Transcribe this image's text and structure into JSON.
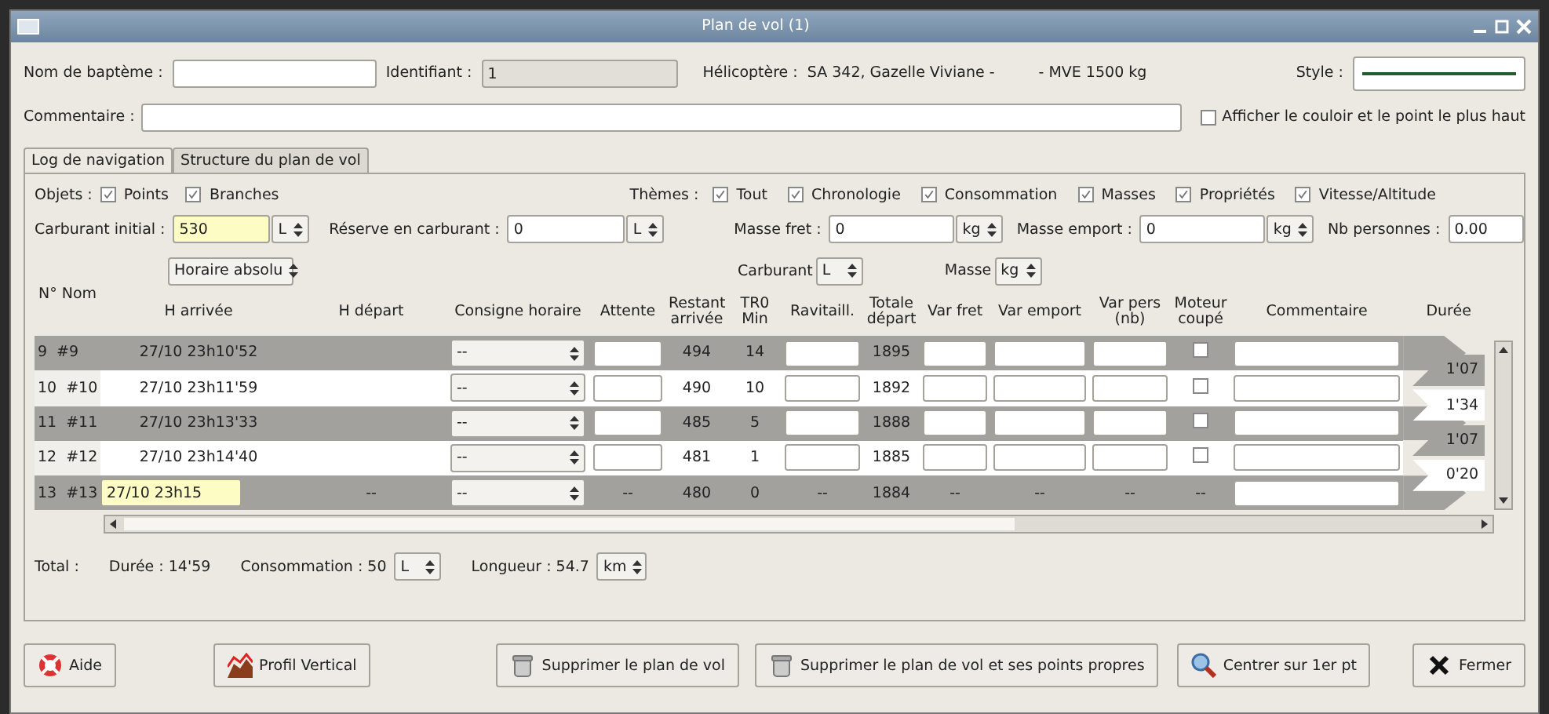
{
  "window": {
    "title": "Plan de vol (1)"
  },
  "header": {
    "name_label": "Nom de baptème :",
    "id_label": "Identifiant :",
    "id_value": "1",
    "helicopter_label": "Hélicoptère :",
    "helicopter": "SA 342, Gazelle Viviane -",
    "mve": "- MVE 1500 kg",
    "style_label": "Style :",
    "comment_label": "Commentaire :",
    "corridor": {
      "label": "Afficher le couloir et le point le plus haut",
      "checked": false
    }
  },
  "tabs": [
    {
      "label": "Log de navigation",
      "selected": true
    },
    {
      "label": "Structure du plan de vol",
      "selected": false
    }
  ],
  "filters": {
    "objects_label": "Objets :",
    "objects": [
      {
        "label": "Points",
        "checked": true
      },
      {
        "label": "Branches",
        "checked": true
      }
    ],
    "themes_label": "Thèmes :",
    "themes": [
      {
        "label": "Tout",
        "checked": true
      },
      {
        "label": "Chronologie",
        "checked": true
      },
      {
        "label": "Consommation",
        "checked": true
      },
      {
        "label": "Masses",
        "checked": true
      },
      {
        "label": "Propriétés",
        "checked": true
      },
      {
        "label": "Vitesse/Altitude",
        "checked": true
      }
    ]
  },
  "settings": [
    {
      "label": "Carburant initial :",
      "value": "530",
      "unit": "L",
      "highlighted": true
    },
    {
      "label": "Réserve en carburant :",
      "value": "0",
      "unit": "L",
      "highlighted": false
    },
    {
      "label": "Masse fret :",
      "value": "0",
      "unit": "kg",
      "highlighted": false
    },
    {
      "label": "Masse emport :",
      "value": "0",
      "unit": "kg",
      "highlighted": false
    },
    {
      "label": "Nb personnes :",
      "value": "0.00",
      "highlighted": false
    }
  ],
  "table": {
    "time_mode": "Horaire absolu",
    "fuel_label": "Carburant",
    "fuel_unit": "L",
    "mass_label": "Masse",
    "mass_unit": "kg",
    "columns": [
      "N° Nom",
      "H arrivée",
      "H départ",
      "Consigne horaire",
      "Attente",
      "Restant arrivée",
      "TR0 Min",
      "Ravitaill.",
      "Totale départ",
      "Var fret",
      "Var emport",
      "Var pers (nb)",
      "Moteur coupé",
      "Commentaire",
      "Durée"
    ],
    "rows": [
      {
        "kind": "waypoint",
        "num": "9",
        "name": "#9",
        "h_arrivee": "27/10 23h10'52",
        "consigne": "--",
        "restant": "494",
        "tr0": "14",
        "totale": "1895",
        "engine_off": false
      },
      {
        "kind": "waypoint",
        "num": "10",
        "name": "#10",
        "h_arrivee": "27/10 23h11'59",
        "consigne": "--",
        "restant": "490",
        "tr0": "10",
        "totale": "1892",
        "engine_off": false
      },
      {
        "kind": "waypoint",
        "num": "11",
        "name": "#11",
        "h_arrivee": "27/10 23h13'33",
        "consigne": "--",
        "restant": "485",
        "tr0": "5",
        "totale": "1888",
        "engine_off": false
      },
      {
        "kind": "waypoint",
        "num": "12",
        "name": "#12",
        "h_arrivee": "27/10 23h14'40",
        "consigne": "--",
        "restant": "481",
        "tr0": "1",
        "totale": "1885",
        "engine_off": false
      },
      {
        "kind": "arrival",
        "num": "13",
        "name": "#13",
        "h_arrivee": "27/10 23h15",
        "h_depart": "--",
        "consigne": "--",
        "attente": "--",
        "restant": "480",
        "tr0": "0",
        "ravitaill": "--",
        "totale": "1884",
        "var_fret": "--",
        "var_emport": "--",
        "var_pers": "--",
        "moteur": "--"
      }
    ],
    "durations": [
      "1'07",
      "1'34",
      "1'07",
      "0'20"
    ]
  },
  "totals": {
    "label": "Total :",
    "duration": "Durée : 14'59",
    "consumption": "Consommation : 50",
    "consumption_unit": "L",
    "length": "Longueur : 54.7",
    "length_unit": "km"
  },
  "buttons": [
    {
      "kind": "help",
      "label": "Aide"
    },
    {
      "kind": "profile",
      "label": "Profil Vertical"
    },
    {
      "kind": "delete",
      "label": "Supprimer le plan de vol"
    },
    {
      "kind": "delete",
      "label": "Supprimer le plan de vol et ses points propres"
    },
    {
      "kind": "center",
      "label": "Centrer sur 1er pt"
    },
    {
      "kind": "close",
      "label": "Fermer"
    }
  ]
}
